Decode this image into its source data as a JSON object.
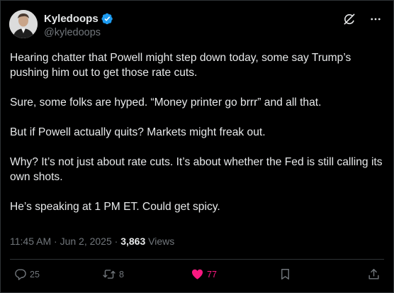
{
  "author": {
    "name": "Kyledoops",
    "handle": "@kyledoops",
    "verified": true
  },
  "tweet": {
    "paragraphs": [
      "Hearing chatter that Powell might step down today, some say Trump’s pushing him out to get those rate cuts.",
      "Sure, some folks are hyped. “Money printer go brrr” and all that.",
      "But if Powell actually quits? Markets might freak out.",
      "Why? It’s not just about rate cuts. It’s about whether the Fed is still calling its own shots.",
      "He’s speaking at 1 PM ET. Could get spicy."
    ],
    "time": "11:45 AM",
    "separator": "·",
    "date": "Jun 2, 2025",
    "views_count": "3,863",
    "views_label": "Views"
  },
  "actions": {
    "replies": "25",
    "retweets": "8",
    "likes": "77"
  },
  "icons": {
    "grok": "grok-icon",
    "more": "more-icon",
    "reply": "reply-icon",
    "retweet": "retweet-icon",
    "like": "heart-icon",
    "bookmark": "bookmark-icon",
    "share": "share-icon"
  },
  "colors": {
    "background": "#000000",
    "text": "#e7e9ea",
    "secondary": "#71767b",
    "verified": "#1d9bf0",
    "like": "#f91880",
    "border": "#2f3336"
  }
}
